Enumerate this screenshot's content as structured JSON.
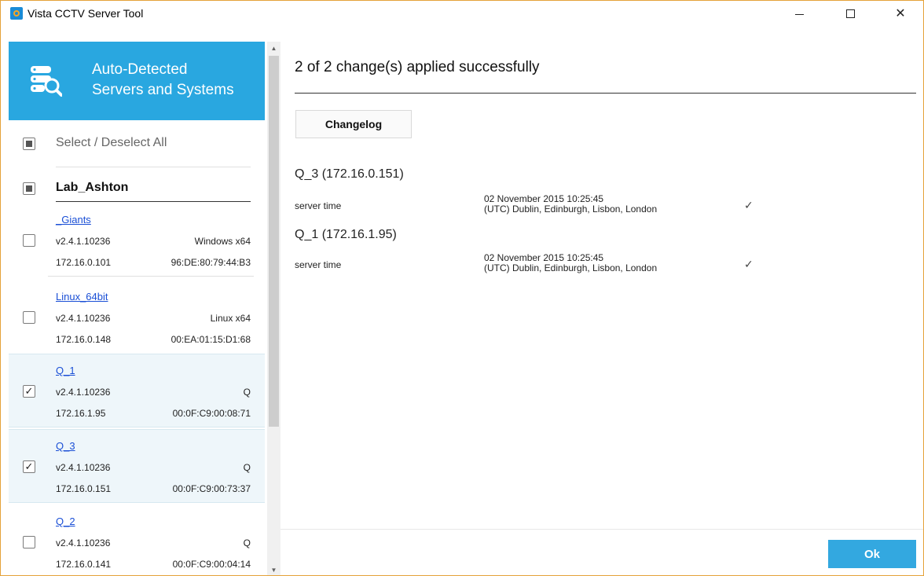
{
  "window": {
    "title": "Vista CCTV Server Tool"
  },
  "sidebar": {
    "header": {
      "line1": "Auto-Detected",
      "line2": "Servers and Systems"
    },
    "select_all_label": "Select / Deselect All",
    "group": "Lab_Ashton",
    "servers": [
      {
        "name": "_Giants",
        "version": "v2.4.1.10236",
        "os": "Windows x64",
        "ip": "172.16.0.101",
        "mac": "96:DE:80:79:44:B3",
        "checked": false
      },
      {
        "name": "Linux_64bit",
        "version": "v2.4.1.10236",
        "os": "Linux x64",
        "ip": "172.16.0.148",
        "mac": "00:EA:01:15:D1:68",
        "checked": false
      },
      {
        "name": "Q_1",
        "version": "v2.4.1.10236",
        "os": "Q",
        "ip": "172.16.1.95",
        "mac": "00:0F:C9:00:08:71",
        "checked": true
      },
      {
        "name": "Q_3",
        "version": "v2.4.1.10236",
        "os": "Q",
        "ip": "172.16.0.151",
        "mac": "00:0F:C9:00:73:37",
        "checked": true
      },
      {
        "name": "Q_2",
        "version": "v2.4.1.10236",
        "os": "Q",
        "ip": "172.16.0.141",
        "mac": "00:0F:C9:00:04:14",
        "checked": false
      }
    ]
  },
  "main": {
    "status": "2 of 2 change(s) applied successfully",
    "changelog_label": "Changelog",
    "changes": [
      {
        "server": "Q_3 (172.16.0.151)",
        "key": "server time",
        "value_line1": "02 November 2015 10:25:45",
        "value_line2": "(UTC) Dublin, Edinburgh, Lisbon, London",
        "status": "✓"
      },
      {
        "server": "Q_1 (172.16.1.95)",
        "key": "server time",
        "value_line1": "02 November 2015 10:25:45",
        "value_line2": "(UTC) Dublin, Edinburgh, Lisbon, London",
        "status": "✓"
      }
    ],
    "ok_label": "Ok"
  },
  "icons": {
    "minimize": "—",
    "maximize": "□",
    "close": "✕",
    "scroll_up": "▲",
    "scroll_down": "▼",
    "check": "✓"
  },
  "colors": {
    "accent": "#29a7e0",
    "ok_button": "#33a8e0",
    "link": "#1a4fd6",
    "selected_row": "#eef6fa"
  }
}
